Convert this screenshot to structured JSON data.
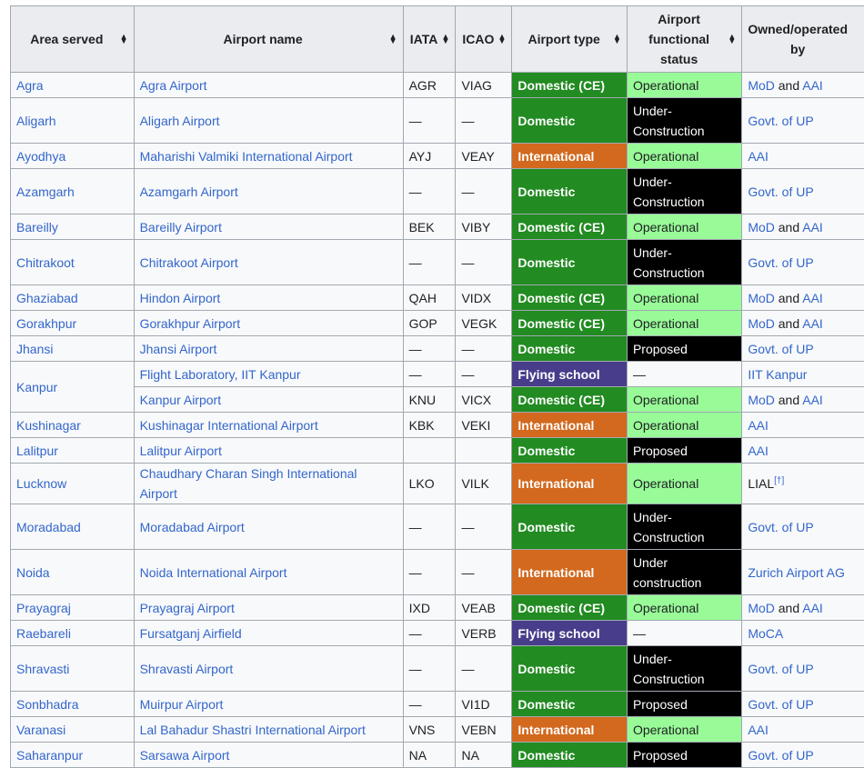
{
  "headers": {
    "area": "Area served",
    "airport": "Airport name",
    "iata": "IATA",
    "icao": "ICAO",
    "type": "Airport type",
    "status_l1": "Airport",
    "status_l2": "functional",
    "status_l3": "status",
    "owner_l1": "Owned/operated",
    "owner_l2": "by"
  },
  "and_word": "and",
  "rows": [
    {
      "area": "Agra",
      "airport": "Agra Airport",
      "iata": "AGR",
      "icao": "VIAG",
      "type": "Domestic (CE)",
      "status": "Operational",
      "owner": "MoD",
      "owner2": "AAI"
    },
    {
      "area": "Aligarh",
      "airport": "Aligarh Airport",
      "iata": "—",
      "icao": "—",
      "type": "Domestic",
      "status_a": "Under-",
      "status_b": "Construction",
      "owner": "Govt. of UP"
    },
    {
      "area": "Ayodhya",
      "airport": "Maharishi Valmiki International Airport",
      "iata": "AYJ",
      "icao": "VEAY",
      "type": "International",
      "status": "Operational",
      "owner": "AAI"
    },
    {
      "area": "Azamgarh",
      "airport": "Azamgarh Airport",
      "iata": "—",
      "icao": "—",
      "type": "Domestic",
      "status_a": "Under-",
      "status_b": "Construction",
      "owner": "Govt. of UP"
    },
    {
      "area": "Bareilly",
      "airport": "Bareilly Airport",
      "iata": "BEK",
      "icao": "VIBY",
      "type": "Domestic (CE)",
      "status": "Operational",
      "owner": "MoD",
      "owner2": "AAI"
    },
    {
      "area": "Chitrakoot",
      "airport": "Chitrakoot Airport",
      "iata": "—",
      "icao": "—",
      "type": "Domestic",
      "status_a": "Under-",
      "status_b": "Construction",
      "owner": "Govt. of UP"
    },
    {
      "area": "Ghaziabad",
      "airport": "Hindon Airport",
      "iata": "QAH",
      "icao": "VIDX",
      "type": "Domestic (CE)",
      "status": "Operational",
      "owner": "MoD",
      "owner2": "AAI"
    },
    {
      "area": "Gorakhpur",
      "airport": "Gorakhpur Airport",
      "iata": "GOP",
      "icao": "VEGK",
      "type": "Domestic (CE)",
      "status": "Operational",
      "owner": "MoD",
      "owner2": "AAI"
    },
    {
      "area": "Jhansi",
      "airport": "Jhansi Airport",
      "iata": "—",
      "icao": "—",
      "type": "Domestic",
      "status": "Proposed",
      "owner": "Govt. of UP"
    },
    {
      "area": "Kanpur",
      "airport": "Flight Laboratory, IIT Kanpur",
      "iata": "—",
      "icao": "—",
      "type": "Flying school",
      "status": "—",
      "owner": "IIT Kanpur"
    },
    {
      "airport": "Kanpur Airport",
      "iata": "KNU",
      "icao": "VICX",
      "type": "Domestic (CE)",
      "status": "Operational",
      "owner": "MoD",
      "owner2": "AAI"
    },
    {
      "area": "Kushinagar",
      "airport": "Kushinagar International Airport",
      "iata": "KBK",
      "icao": "VEKI",
      "type": "International",
      "status": "Operational",
      "owner": "AAI"
    },
    {
      "area": "Lalitpur",
      "airport": "Lalitpur Airport",
      "iata": "",
      "icao": "",
      "type": "Domestic",
      "status": "Proposed",
      "owner": "AAI"
    },
    {
      "area": "Lucknow",
      "airport": "Chaudhary Charan Singh International Airport",
      "iata": "LKO",
      "icao": "VILK",
      "type": "International",
      "status": "Operational",
      "owner": "LIAL",
      "owner_sup": "[†]"
    },
    {
      "area": "Moradabad",
      "airport": "Moradabad Airport",
      "iata": "—",
      "icao": "—",
      "type": "Domestic",
      "status_a": "Under-",
      "status_b": "Construction",
      "owner": "Govt. of UP"
    },
    {
      "area": "Noida",
      "airport": "Noida International Airport",
      "iata": "—",
      "icao": "—",
      "type": "International",
      "status_a": "Under",
      "status_b": "construction",
      "owner": "Zurich Airport AG"
    },
    {
      "area": "Prayagraj",
      "airport": "Prayagraj Airport",
      "iata": "IXD",
      "icao": "VEAB",
      "type": "Domestic (CE)",
      "status": "Operational",
      "owner": "MoD",
      "owner2": "AAI"
    },
    {
      "area": "Raebareli",
      "airport": "Fursatganj Airfield",
      "iata": "—",
      "icao": "VERB",
      "type": "Flying school",
      "status": "—",
      "owner": "MoCA"
    },
    {
      "area": "Shravasti",
      "airport": "Shravasti Airport",
      "iata": "—",
      "icao": "—",
      "type": "Domestic",
      "status_a": "Under-",
      "status_b": "Construction",
      "owner": "Govt. of UP"
    },
    {
      "area": "Sonbhadra",
      "airport": "Muirpur Airport",
      "iata": "—",
      "icao": "VI1D",
      "type": "Domestic",
      "status": "Proposed",
      "owner": "Govt. of UP"
    },
    {
      "area": "Varanasi",
      "airport": "Lal Bahadur Shastri International Airport",
      "iata": "VNS",
      "icao": "VEBN",
      "type": "International",
      "status": "Operational",
      "owner": "AAI"
    },
    {
      "area": "Saharanpur",
      "airport": "Sarsawa Airport",
      "iata": "NA",
      "icao": "NA",
      "type": "Domestic",
      "status": "Proposed",
      "owner": "Govt. of UP"
    }
  ]
}
